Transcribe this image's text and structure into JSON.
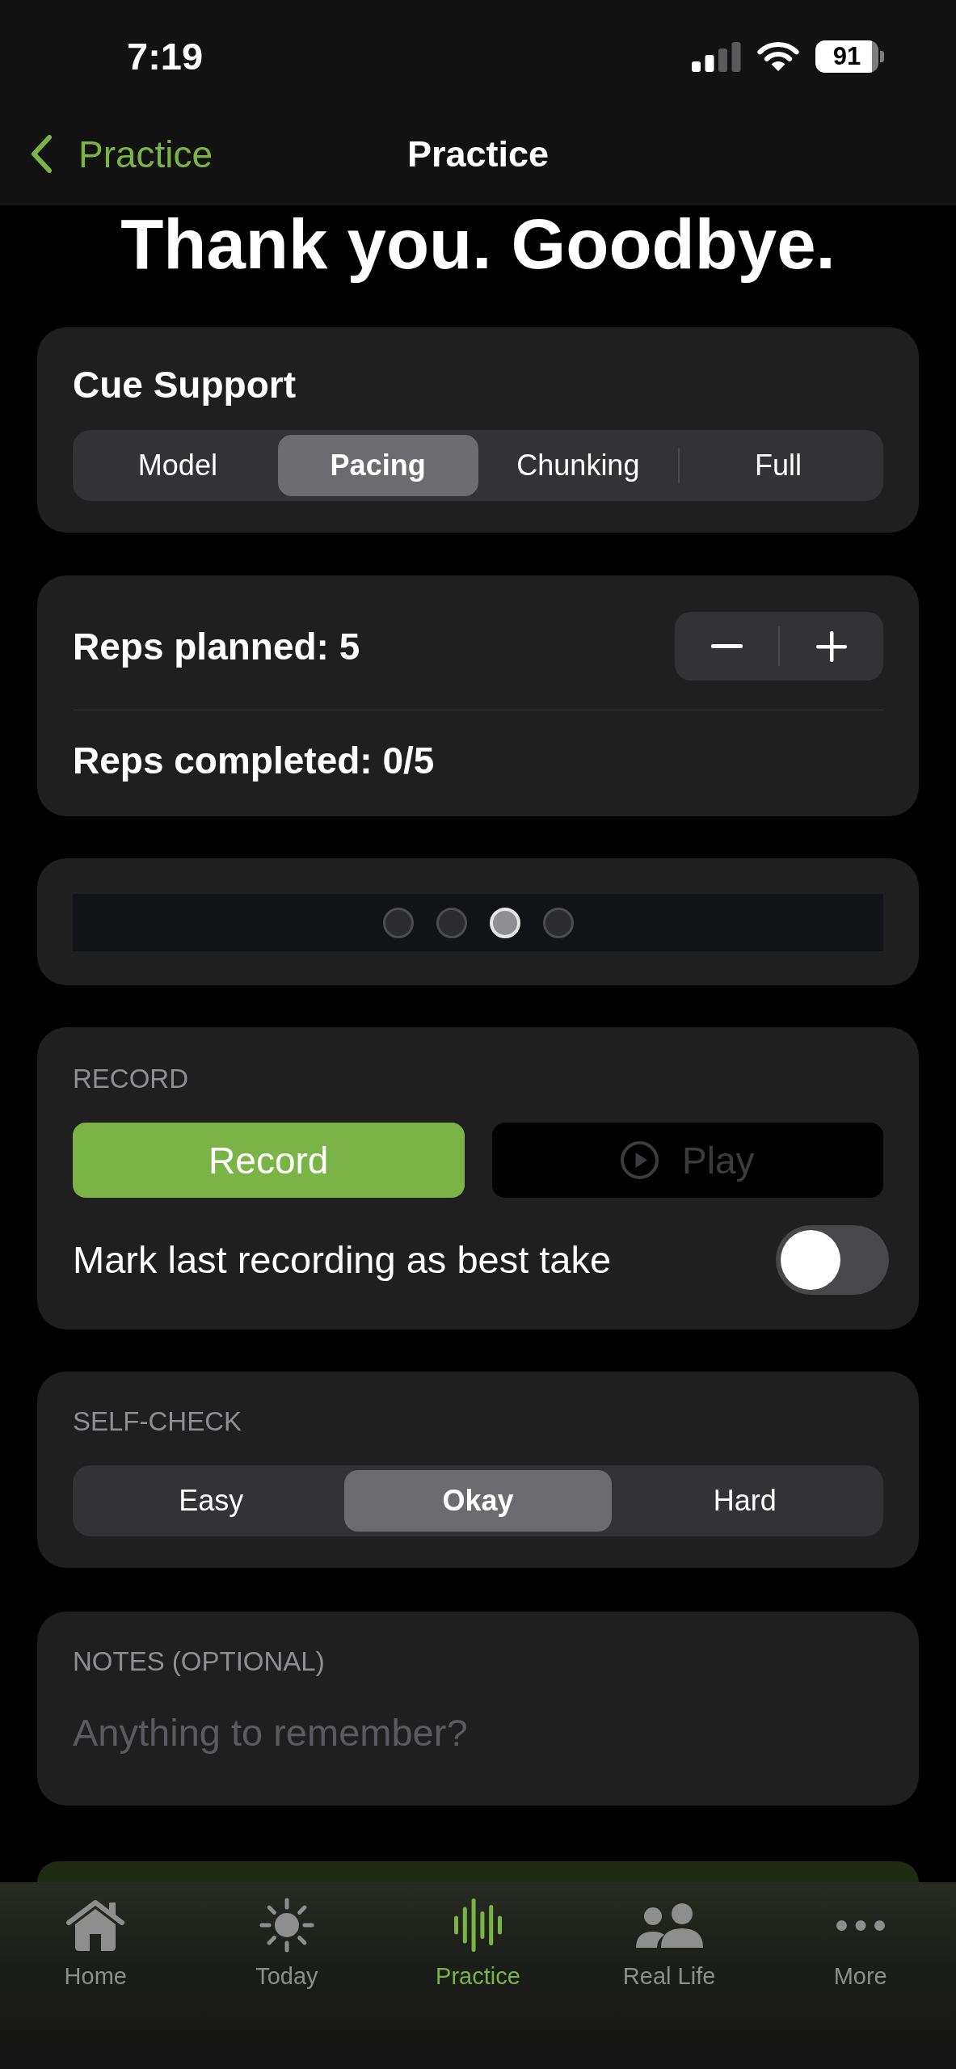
{
  "status_bar": {
    "time": "7:19",
    "battery": "91"
  },
  "nav_bar": {
    "back_label": "Practice",
    "title": "Practice"
  },
  "heading": "Thank you. Goodbye.",
  "cue_support": {
    "title": "Cue Support",
    "options": [
      {
        "label": "Model",
        "selected": false
      },
      {
        "label": "Pacing",
        "selected": true
      },
      {
        "label": "Chunking",
        "selected": false
      },
      {
        "label": "Full",
        "selected": false
      }
    ]
  },
  "reps": {
    "planned": "Reps planned: 5",
    "completed": "Reps completed: 0/5"
  },
  "page_dots": [
    {
      "selected": false
    },
    {
      "selected": false
    },
    {
      "selected": true
    },
    {
      "selected": false
    }
  ],
  "record": {
    "label": "RECORD",
    "buttons": [
      {
        "kind": "record",
        "label": "Record",
        "disabled": false
      },
      {
        "kind": "play",
        "label": "Play",
        "disabled": true
      }
    ],
    "best_take": {
      "label": "Mark last recording as best take",
      "on": false
    }
  },
  "self_check": {
    "label": "SELF-CHECK",
    "options": [
      {
        "label": "Easy",
        "selected": false
      },
      {
        "label": "Okay",
        "selected": true
      },
      {
        "label": "Hard",
        "selected": false
      }
    ]
  },
  "notes": {
    "label": "NOTES (OPTIONAL)",
    "placeholder": "Anything to remember?"
  },
  "tab_bar": [
    {
      "label": "Home",
      "selected": false
    },
    {
      "label": "Today",
      "selected": false
    },
    {
      "label": "Practice",
      "selected": true
    },
    {
      "label": "Real Life",
      "selected": false
    },
    {
      "label": "More",
      "selected": false
    }
  ]
}
